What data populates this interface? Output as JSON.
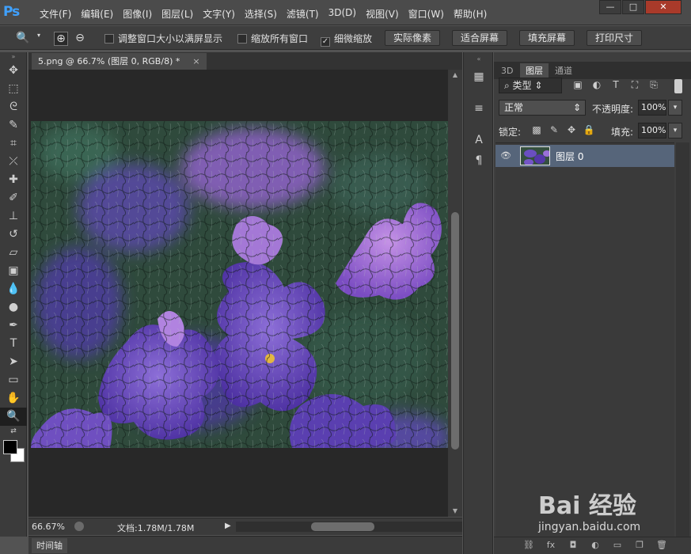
{
  "app": {
    "logo": "Ps"
  },
  "menu": [
    "文件(F)",
    "编辑(E)",
    "图像(I)",
    "图层(L)",
    "文字(Y)",
    "选择(S)",
    "滤镜(T)",
    "3D(D)",
    "视图(V)",
    "窗口(W)",
    "帮助(H)"
  ],
  "window_buttons": {
    "minimize": "—",
    "maximize": "□",
    "close": "✕"
  },
  "options": {
    "resize_windows": "调整窗口大小以满屏显示",
    "zoom_all": "缩放所有窗口",
    "scrubby_zoom": "细微缩放",
    "actual_pixels": "实际像素",
    "fit_screen": "适合屏幕",
    "fill_screen": "填充屏幕",
    "print_size": "打印尺寸",
    "scrubby_checked": true
  },
  "document": {
    "tab_title": "5.png @ 66.7% (图层 0, RGB/8) *",
    "tab_close": "×",
    "zoom": "66.67%",
    "doc_size": "文档:1.78M/1.78M"
  },
  "timeline": {
    "label": "时间轴"
  },
  "panel": {
    "tabs": [
      "3D",
      "图层",
      "通道"
    ],
    "kind": "类型",
    "blend_mode": "正常",
    "opacity_label": "不透明度:",
    "opacity": "100%",
    "lock_label": "锁定:",
    "fill_label": "填充:",
    "fill": "100%",
    "layers": [
      {
        "name": "图层 0"
      }
    ]
  },
  "watermark": {
    "text": "Bai 经验",
    "url": "jingyan.baidu.com"
  },
  "colors": {
    "accent": "#3fa1ff",
    "layer_selected": "#56657a",
    "close": "#a93a2a"
  }
}
